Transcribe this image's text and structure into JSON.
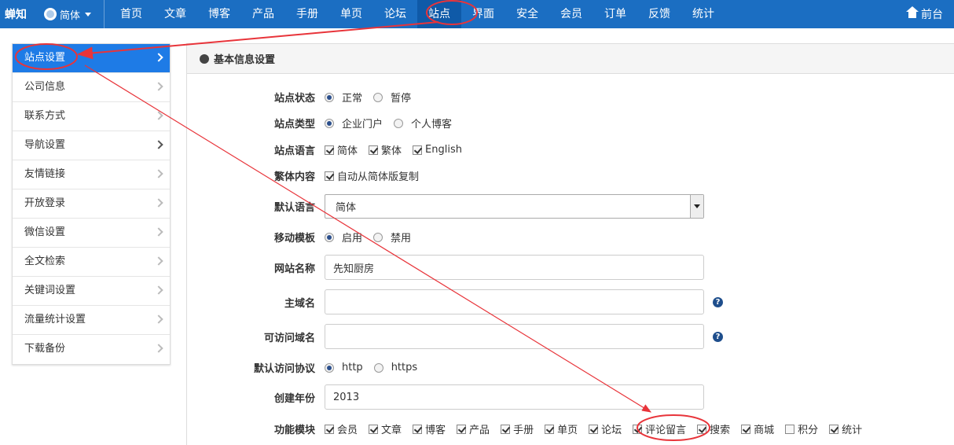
{
  "topbar": {
    "brand": "蝉知",
    "language": "简体",
    "nav": [
      "首页",
      "文章",
      "博客",
      "产品",
      "手册",
      "单页",
      "论坛",
      "站点",
      "界面",
      "安全",
      "会员",
      "订单",
      "反馈",
      "统计"
    ],
    "active_nav": "站点",
    "front_label": "前台"
  },
  "sidebar": {
    "items": [
      {
        "label": "站点设置",
        "active": true
      },
      {
        "label": "公司信息"
      },
      {
        "label": "联系方式"
      },
      {
        "label": "导航设置"
      },
      {
        "label": "友情链接"
      },
      {
        "label": "开放登录"
      },
      {
        "label": "微信设置"
      },
      {
        "label": "全文检索"
      },
      {
        "label": "关键词设置"
      },
      {
        "label": "流量统计设置"
      },
      {
        "label": "下载备份"
      }
    ]
  },
  "panel": {
    "title": "基本信息设置",
    "status": {
      "label": "站点状态",
      "options": [
        "正常",
        "暂停"
      ],
      "selected": "正常"
    },
    "type": {
      "label": "站点类型",
      "options": [
        "企业门户",
        "个人博客"
      ],
      "selected": "企业门户"
    },
    "language": {
      "label": "站点语言",
      "options": [
        "简体",
        "繁体",
        "English"
      ]
    },
    "traditional": {
      "label": "繁体内容",
      "option": "自动从简体版复制"
    },
    "default_lang": {
      "label": "默认语言",
      "value": "简体"
    },
    "mobile": {
      "label": "移动模板",
      "options": [
        "启用",
        "禁用"
      ],
      "selected": "启用"
    },
    "site_name": {
      "label": "网站名称",
      "value": "先知厨房"
    },
    "domain": {
      "label": "主域名",
      "value": ""
    },
    "alias_domain": {
      "label": "可访问域名",
      "value": ""
    },
    "protocol": {
      "label": "默认访问协议",
      "options": [
        "http",
        "https"
      ],
      "selected": "http"
    },
    "year": {
      "label": "创建年份",
      "value": "2013"
    },
    "modules": {
      "label": "功能模块",
      "items": [
        {
          "label": "会员",
          "checked": true
        },
        {
          "label": "文章",
          "checked": true
        },
        {
          "label": "博客",
          "checked": true
        },
        {
          "label": "产品",
          "checked": true
        },
        {
          "label": "手册",
          "checked": true
        },
        {
          "label": "单页",
          "checked": true
        },
        {
          "label": "论坛",
          "checked": true
        },
        {
          "label": "评论留言",
          "checked": true
        },
        {
          "label": "搜索",
          "checked": true
        },
        {
          "label": "商城",
          "checked": true
        },
        {
          "label": "积分",
          "checked": false
        },
        {
          "label": "统计",
          "checked": true
        }
      ]
    }
  },
  "colors": {
    "topbar": "#1b6ec2",
    "active_sidebar": "#1e7be6",
    "annotation": "#e8343a"
  }
}
